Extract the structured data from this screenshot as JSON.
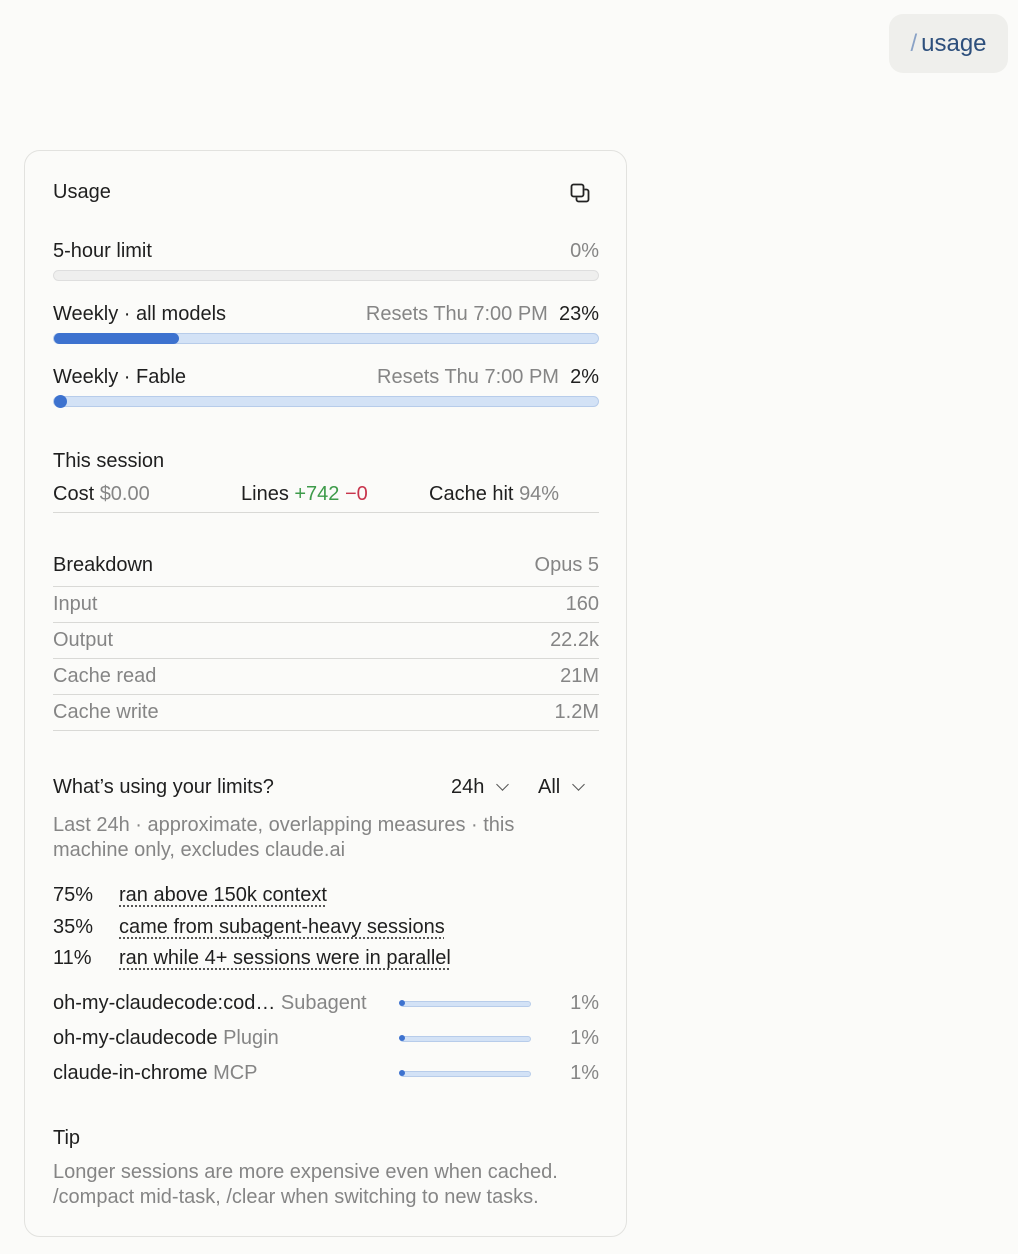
{
  "command": {
    "slash": "/",
    "text": "usage"
  },
  "card": {
    "title": "Usage",
    "limits": [
      {
        "label": "5-hour limit",
        "reset": "",
        "percent_text": "0%",
        "percent": 0
      },
      {
        "label": "Weekly · all models",
        "reset": "Resets Thu 7:00 PM",
        "percent_text": "23%",
        "percent": 23
      },
      {
        "label": "Weekly · Fable",
        "reset": "Resets Thu 7:00 PM",
        "percent_text": "2%",
        "percent": 2
      }
    ],
    "session": {
      "title": "This session",
      "cost_label": "Cost",
      "cost_value": "$0.00",
      "lines_label": "Lines",
      "lines_added": "+742",
      "lines_removed": "−0",
      "cache_label": "Cache hit",
      "cache_value": "94%"
    },
    "breakdown": {
      "title": "Breakdown",
      "model": "Opus 5",
      "rows": [
        {
          "label": "Input",
          "value": "160"
        },
        {
          "label": "Output",
          "value": "22.2k"
        },
        {
          "label": "Cache read",
          "value": "21M"
        },
        {
          "label": "Cache write",
          "value": "1.2M"
        }
      ]
    },
    "limits_usage": {
      "title": "What’s using your limits?",
      "range": "24h",
      "filter": "All",
      "note_line1": "Last 24h · approximate, overlapping measures · this",
      "note_line2": "machine only, excludes claude.ai",
      "factors": [
        {
          "pct": "75%",
          "text": "ran above 150k context"
        },
        {
          "pct": "35%",
          "text": "came from subagent-heavy sessions"
        },
        {
          "pct": "11%",
          "text": "ran while 4+ sessions were in parallel"
        }
      ],
      "sources": [
        {
          "name": "oh-my-claudecode:cod…",
          "kind": "Subagent",
          "pct": "1%",
          "fraction": 0.01
        },
        {
          "name": "oh-my-claudecode",
          "kind": "Plugin",
          "pct": "1%",
          "fraction": 0.01
        },
        {
          "name": "claude-in-chrome",
          "kind": "MCP",
          "pct": "1%",
          "fraction": 0.01
        }
      ]
    },
    "tip": {
      "title": "Tip",
      "line1": "Longer sessions are more expensive even when cached.",
      "line2": "/compact mid-task, /clear when switching to new tasks."
    }
  }
}
